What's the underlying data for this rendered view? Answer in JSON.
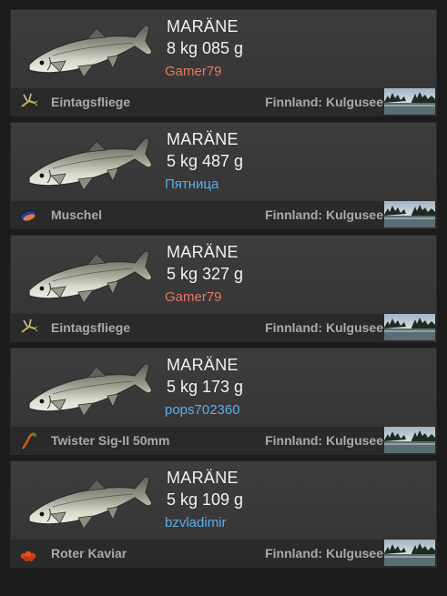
{
  "catches": [
    {
      "fish": "MARÄNE",
      "weight": "8 kg 085 g",
      "player": "Gamer79",
      "player_color": "#e8775e",
      "bait": "Eintagsfliege",
      "bait_icon": "mayfly-icon",
      "location": "Finnland: Kulgusee"
    },
    {
      "fish": "MARÄNE",
      "weight": "5 kg 487 g",
      "player": "Пятница",
      "player_color": "#5aaee8",
      "bait": "Muschel",
      "bait_icon": "mussel-icon",
      "location": "Finnland: Kulgusee"
    },
    {
      "fish": "MARÄNE",
      "weight": "5 kg 327 g",
      "player": "Gamer79",
      "player_color": "#e8775e",
      "bait": "Eintagsfliege",
      "bait_icon": "mayfly-icon",
      "location": "Finnland: Kulgusee"
    },
    {
      "fish": "MARÄNE",
      "weight": "5 kg 173 g",
      "player": "pops702360",
      "player_color": "#5aaee8",
      "bait": "Twister Sig-II 50mm",
      "bait_icon": "twister-lure-icon",
      "location": "Finnland: Kulgusee"
    },
    {
      "fish": "MARÄNE",
      "weight": "5 kg 109 g",
      "player": "bzvladimir",
      "player_color": "#5aaee8",
      "bait": "Roter Kaviar",
      "bait_icon": "red-caviar-icon",
      "location": "Finnland: Kulgusee"
    }
  ]
}
